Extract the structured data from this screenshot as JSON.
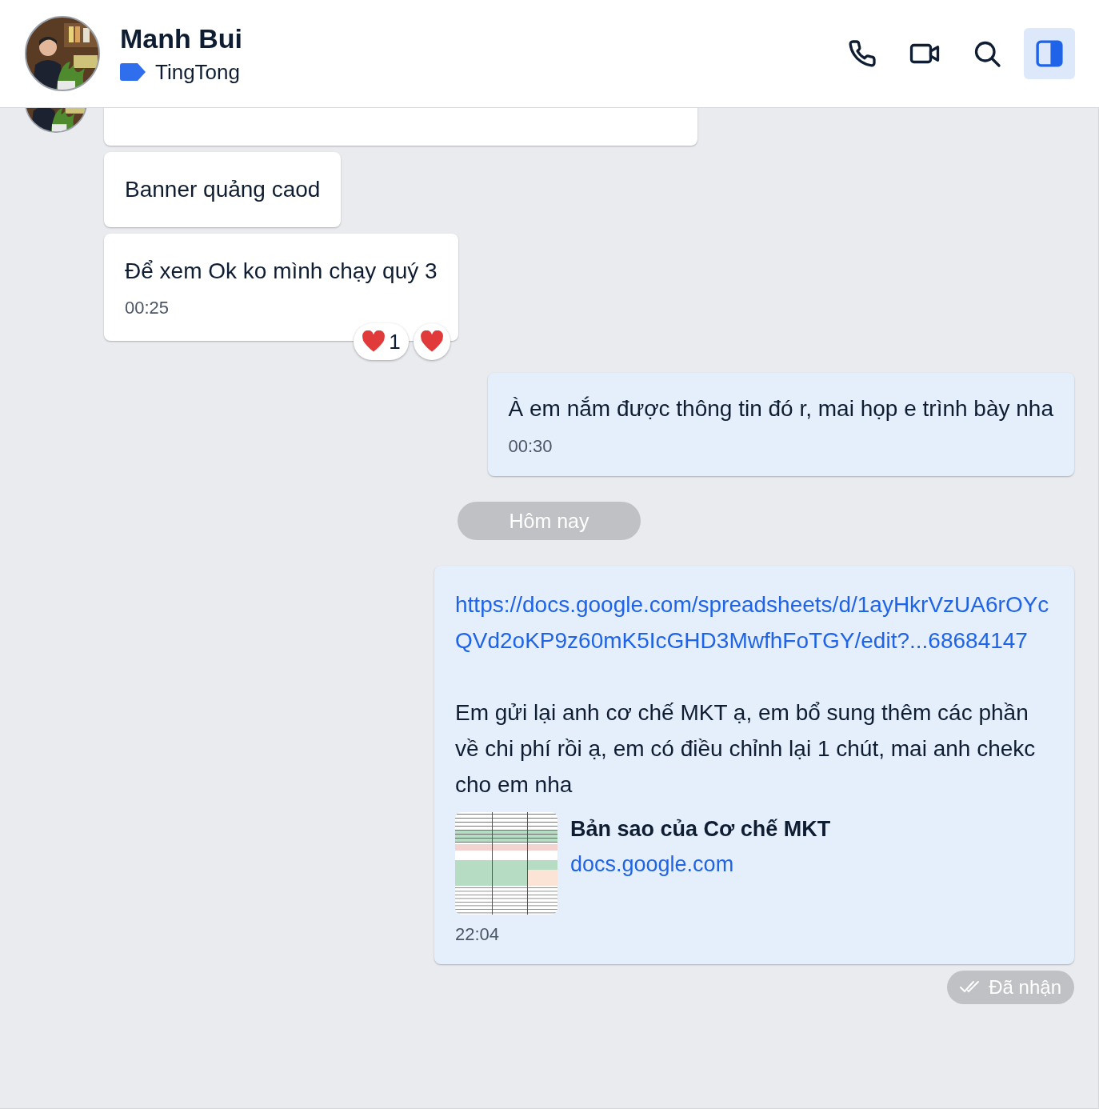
{
  "header": {
    "name": "Manh Bui",
    "tag": {
      "label": "TingTong",
      "color": "#2f6fed"
    },
    "actions": [
      {
        "kind": "phone",
        "selected": false
      },
      {
        "kind": "video",
        "selected": false
      },
      {
        "kind": "search",
        "selected": false
      },
      {
        "kind": "sidebar",
        "selected": true
      }
    ]
  },
  "messages": [
    {
      "kind": "received",
      "avatar": true
    },
    {
      "kind": "received",
      "text": "Banner quảng caod"
    },
    {
      "kind": "received",
      "text": "Để xem Ok ko mình chạy quý 3",
      "time": "00:25",
      "reactions": [
        {
          "kind": "summary",
          "count": "1"
        },
        {
          "kind": "react"
        }
      ]
    },
    {
      "kind": "sent",
      "text": "À em nắm được thông tin đó r, mai họp e trình bày nha",
      "time": "00:30"
    },
    {
      "kind": "date",
      "text": "Hôm nay"
    },
    {
      "kind": "sent",
      "link": "https://docs.google.com/spreadsheets/d/1ayHkrVzUA6rOYcQVd2oKP9z60mK5IcGHD3MwfhFoTGY/edit?...68684147",
      "text": "Em gửi lại anh cơ chế MKT ạ, em bổ sung thêm các phần về chi phí rồi ạ, em có điều chỉnh lại 1 chút, mai anh chekc cho em nha",
      "preview": {
        "title": "Bản sao của Cơ chế MKT",
        "domain": "docs.google.com"
      },
      "time": "22:04"
    },
    {
      "kind": "status",
      "text": "Đã nhận"
    }
  ]
}
